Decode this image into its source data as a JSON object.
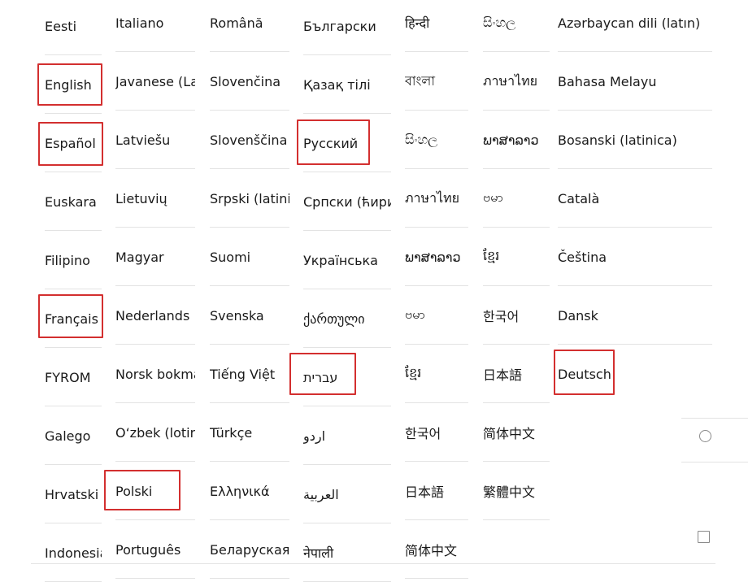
{
  "columns": [
    {
      "items": [
        "Eesti",
        "English",
        "Español",
        "Euskara",
        "Filipino",
        "Français",
        "FYROM",
        "Galego",
        "Hrvatski",
        "Indonesia"
      ]
    },
    {
      "items": [
        "Italiano",
        "Javanese (Latin)",
        "Latviešu",
        "Lietuvių",
        "Magyar",
        "Nederlands",
        "Norsk bokmål",
        "O‘zbek (lotin)",
        "Polski",
        "Português"
      ]
    },
    {
      "items": [
        "Română",
        "Slovenčina",
        "Slovenščina",
        "Srpski (latinica)",
        "Suomi",
        "Svenska",
        "Tiếng Việt",
        "Türkçe",
        "Ελληνικά",
        "Беларуская"
      ]
    },
    {
      "items": [
        "Български",
        "Қазақ тілі",
        "Русский",
        "Српски (ћирилица)",
        "Українська",
        "ქართული",
        "עברית",
        "اردو",
        "العربية",
        "नेपाली"
      ]
    },
    {
      "items": [
        "हिन्दी",
        "বাংলা",
        "සිංහල",
        "ภาษาไทย",
        "ພາສາລາວ",
        "ဗမာ",
        "ខ្មែរ",
        "한국어",
        "日本語",
        "简体中文"
      ]
    },
    {
      "items": [
        "සිංහල",
        "ภาษาไทย",
        "ພາສາລາວ",
        "ဗမာ",
        "ខ្មែរ",
        "한국어",
        "日本語",
        "简体中文",
        "繁體中文"
      ]
    },
    {
      "items": [
        "Azərbaycan dili (latın)",
        "Bahasa Melayu",
        "Bosanski (latinica)",
        "Català",
        "Čeština",
        "Dansk",
        "Deutsch"
      ]
    }
  ],
  "highlighted": [
    "English",
    "Español",
    "Français",
    "Polski",
    "Русский",
    "עברית",
    "Deutsch"
  ]
}
